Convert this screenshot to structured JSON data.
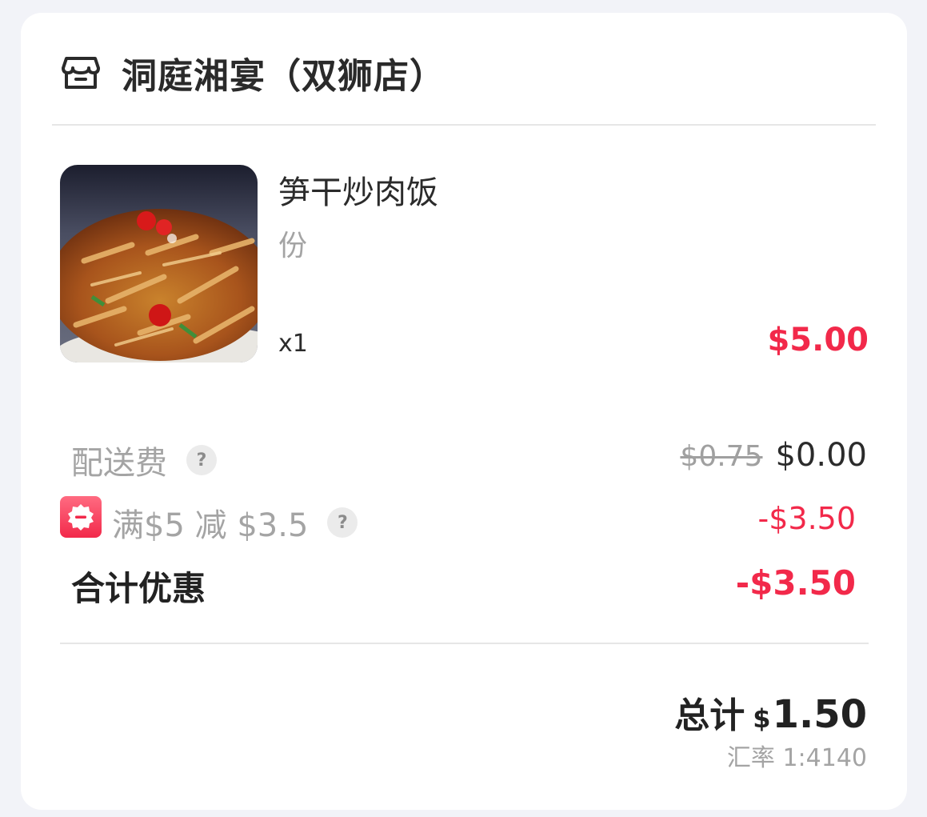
{
  "store": {
    "icon": "storefront-icon",
    "name": "洞庭湘宴（双狮店）"
  },
  "item": {
    "image": "food-photo",
    "name": "笋干炒肉饭",
    "spec": "份",
    "quantity": "x1",
    "price": "$5.00"
  },
  "fees": {
    "delivery": {
      "label": "配送费",
      "help_icon": "question-mark-icon",
      "help_text": "?",
      "original_price": "$0.75",
      "current_price": "$0.00"
    },
    "promotion": {
      "badge_icon": "discount-badge-icon",
      "label": "满$5 减 $3.5",
      "help_icon": "question-mark-icon",
      "help_text": "?",
      "amount": "-$3.50"
    },
    "total_discount": {
      "label": "合计优惠",
      "amount": "-$3.50"
    }
  },
  "total": {
    "label": "总计",
    "currency": "$",
    "value": "1.50",
    "exchange_rate": "汇率 1:4140"
  },
  "colors": {
    "accent_red": "#f2294a",
    "text_dark": "#222222",
    "text_gray": "#a4a4a4",
    "background": "#f2f3f8"
  }
}
